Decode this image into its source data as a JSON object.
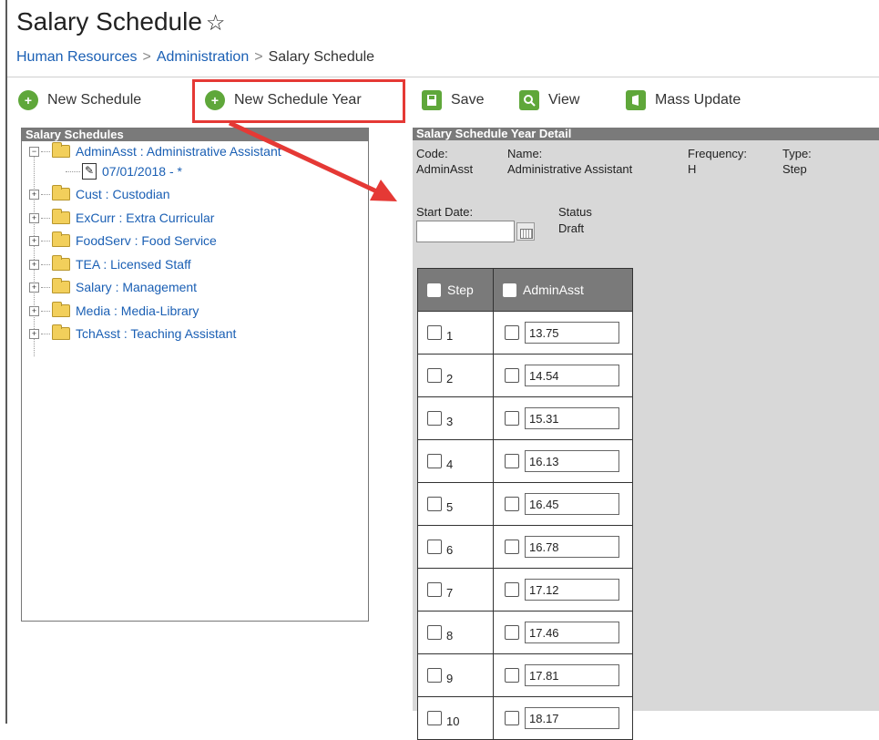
{
  "page": {
    "title": "Salary Schedule",
    "star": "☆",
    "breadcrumb": [
      "Human Resources",
      "Administration",
      "Salary Schedule"
    ]
  },
  "toolbar": {
    "new_schedule": "New Schedule",
    "new_schedule_year": "New Schedule Year",
    "save": "Save",
    "view": "View",
    "mass_update": "Mass Update"
  },
  "left_panel": {
    "header": "Salary Schedules",
    "items": [
      "AdminAsst : Administrative Assistant",
      "07/01/2018 - *",
      "Cust : Custodian",
      "ExCurr : Extra Curricular",
      "FoodServ : Food Service",
      "TEA : Licensed Staff",
      "Salary : Management",
      "Media : Media-Library",
      "TchAsst : Teaching Assistant"
    ]
  },
  "detail": {
    "header": "Salary Schedule Year Detail",
    "code_label": "Code:",
    "code_value": "AdminAsst",
    "name_label": "Name:",
    "name_value": "Administrative Assistant",
    "frequency_label": "Frequency:",
    "frequency_value": "H",
    "type_label": "Type:",
    "type_value": "Step",
    "start_date_label": "Start Date:",
    "start_date_value": "",
    "status_label": "Status",
    "status_value": "Draft"
  },
  "grid": {
    "col_step": "Step",
    "col_value": "AdminAsst",
    "rows": [
      {
        "step": "1",
        "value": "13.75"
      },
      {
        "step": "2",
        "value": "14.54"
      },
      {
        "step": "3",
        "value": "15.31"
      },
      {
        "step": "4",
        "value": "16.13"
      },
      {
        "step": "5",
        "value": "16.45"
      },
      {
        "step": "6",
        "value": "16.78"
      },
      {
        "step": "7",
        "value": "17.12"
      },
      {
        "step": "8",
        "value": "17.46"
      },
      {
        "step": "9",
        "value": "17.81"
      },
      {
        "step": "10",
        "value": "18.17"
      }
    ]
  },
  "colors": {
    "accent_green": "#5fa73a",
    "highlight_red": "#e53935",
    "link_blue": "#1a5fb4",
    "panel_header_gray": "#7a7a7a"
  }
}
